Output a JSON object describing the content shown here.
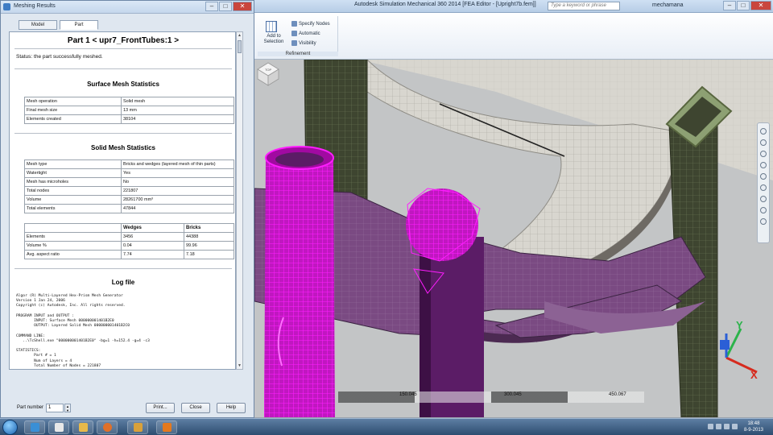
{
  "app": {
    "title": "Autodesk Simulation Mechanical 360 2014   [FEA Editor - [Upright7b.fem]]",
    "search_placeholder": "Type a keyword or phrase",
    "user": "mechamana"
  },
  "ribbon": {
    "add_to_selection": "Add to Selection",
    "specify_nodes": "Specify Nodes",
    "automatic": "Automatic",
    "visibility": "Visibility",
    "group_label": "Refinement"
  },
  "dialog": {
    "title": "Meshing Results",
    "tabs": [
      "Model",
      "Part"
    ],
    "active_tab": "Part",
    "part_title": "Part 1 < upr7_FrontTubes:1 >",
    "status": "Status: the part successfully meshed.",
    "surface_title": "Surface Mesh Statistics",
    "surface_rows": [
      {
        "k": "Mesh operation",
        "v": "Solid mesh"
      },
      {
        "k": "Final mesh size",
        "v": "13 mm"
      },
      {
        "k": "Elements created",
        "v": "38104"
      }
    ],
    "solid_title": "Solid Mesh Statistics",
    "solid_rows": [
      {
        "k": "Mesh type",
        "v": "Bricks and wedges (layered mesh of thin parts)"
      },
      {
        "k": "Watertight",
        "v": "Yes"
      },
      {
        "k": "Mesh has microholes",
        "v": "No"
      },
      {
        "k": "Total nodes",
        "v": "221807"
      },
      {
        "k": "Volume",
        "v": "28261700 mm³"
      },
      {
        "k": "Total elements",
        "v": "47844"
      }
    ],
    "elem_header": {
      "k": "",
      "w": "Wedges",
      "b": "Bricks"
    },
    "elem_rows": [
      {
        "k": "Elements",
        "w": "3456",
        "b": "44388"
      },
      {
        "k": "Volume %",
        "w": "0.04",
        "b": "99.96"
      },
      {
        "k": "Avg. aspect ratio",
        "w": "7.74",
        "b": "7.18"
      }
    ],
    "log_title": "Log file",
    "log_text": "Algor (R) Multi-Layered Hex-Prism Mesh Generator\nVersion 1 Jan 24, 2006\nCopyright (c) Autodesk, Inc. All rights reserved.\n\nPROGRAM INPUT and OUTPUT :\n        INPUT: Surface Mesh 000000001401B2E0\n        OUTPUT: Layered Solid Mesh 000000001401B2C0\n\nCOMMAND LINE:\n   ..\\TcShell.exe \"000000001401B2E0\" -bg=1 -h=152.4 -g=4 -c3\n\nSTATISTICS:\n        Part # = 1\n        Num of Layers = 4\n        Total Number of Nodes = 221807",
    "part_number_label": "Part number",
    "part_number_value": "1",
    "print_label": "Print...",
    "close_label": "Close",
    "help_label": "Help"
  },
  "viewport": {
    "ruler_labels": [
      "150.045",
      "300.045",
      "450.067"
    ],
    "axis_x": "X",
    "axis_y": "Y",
    "viewcube_label": "TOP"
  },
  "taskbar": {
    "time": "18:48",
    "date": "8-9-2013"
  },
  "colors": {
    "mesh_magenta": "#ff1dff",
    "mesh_dark_green": "#3e4530",
    "mesh_purple": "#7a4a82",
    "mesh_light": "#d8d6cf"
  }
}
